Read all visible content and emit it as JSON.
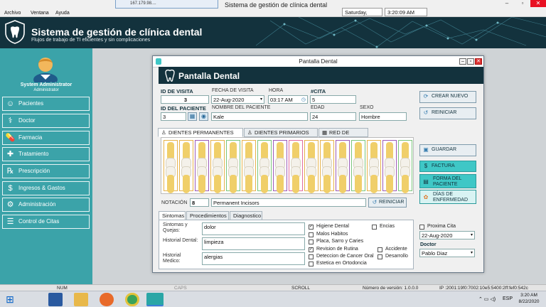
{
  "menubar": {
    "items": [
      "Archivo",
      "Ventana",
      "Ayuda"
    ],
    "rdp_host": "167.179.98....",
    "app_title": "Sistema de gestión de clínica dental",
    "day": "Saturday,",
    "time": "3:20:09 AM"
  },
  "header": {
    "title": "Sistema de gestión de clínica dental",
    "subtitle": "Flujos de trabajo de TI eficientes y sin complicaciones"
  },
  "sidebar": {
    "user_name": "System Administrator",
    "user_role": "Administrator",
    "items": [
      {
        "label": "Pacientes",
        "icon": "patients-icon"
      },
      {
        "label": "Doctor",
        "icon": "doctor-icon"
      },
      {
        "label": "Farmacia",
        "icon": "pill-icon"
      },
      {
        "label": "Tratamiento",
        "icon": "treatment-icon"
      },
      {
        "label": "Prescripción",
        "icon": "rx-icon"
      },
      {
        "label": "Ingresos & Gastos",
        "icon": "money-icon"
      },
      {
        "label": "Administración",
        "icon": "admin-icon"
      },
      {
        "label": "Control de Citas",
        "icon": "calendar-icon"
      }
    ]
  },
  "dialog": {
    "window_title": "Pantalla Dental",
    "header_title": "Pantalla Dental",
    "visit_id_label": "ID DE VISITA",
    "visit_id": "3",
    "visit_date_label": "FECHA DE VISITA",
    "visit_date": "22-Aug-2020",
    "hour_label": "HORA",
    "hour": "03:17 AM",
    "appt_label": "#CITA",
    "appt": "5",
    "patient_id_label": "ID DEL PACIENTE",
    "patient_id": "3",
    "patient_name_label": "NOMBRE DEL PACIENTE",
    "patient_name": "Kale",
    "age_label": "EDAD",
    "age": "24",
    "sex_label": "SEXO",
    "sex": "Hombre",
    "btn_new": "CREAR NUEVO",
    "btn_reset": "REINICIAR",
    "btn_save": "GUARDAR",
    "btn_invoice": "FACTURA",
    "btn_patient_form": "FORMA DEL PACIENTE",
    "btn_sick_days": "DÍAS DE ENFERMEDAD",
    "teeth_tabs": [
      "DIENTES PERMANENTES",
      "DIENTES PRIMARIOS",
      "RED DE NOTACIÓN"
    ],
    "notation_label": "NOTACIÓN",
    "notation_num": "8",
    "notation_text": "Permanent Incisors",
    "btn_notation_reset": "REINICIAR",
    "info_tabs": [
      "Sintomas",
      "Procedimientos",
      "Diagnostico"
    ],
    "symptoms_label": "Sintomas y Quejas:",
    "symptoms": "dolor",
    "dental_history_label": "Historial Dental:",
    "dental_history": "limpieza",
    "medical_history_label": "Historial Medico:",
    "medical_history": "alergias",
    "checks": [
      {
        "label": "Higiene Dental",
        "checked": true
      },
      {
        "label": "Encias",
        "checked": false
      },
      {
        "label": "Malos Habitos",
        "checked": false
      },
      {
        "label": "Placa, Sarro y Caries",
        "checked": false
      },
      {
        "label": "Revision de Rutina",
        "checked": true
      },
      {
        "label": "Accidente",
        "checked": false
      },
      {
        "label": "Deteccion de Cancer Oral",
        "checked": false
      },
      {
        "label": "Desarrollo",
        "checked": false
      },
      {
        "label": "Estetica en Ortodoncia",
        "checked": false
      }
    ],
    "next_appt_label": "Proxima Cita",
    "next_appt_date": "22-Aug-2020",
    "doctor_label": "Doctor",
    "doctor": "Pablo Diaz"
  },
  "statusbar": {
    "num": "NUM",
    "caps": "CAPS",
    "scroll": "SCROLL",
    "version": "Número de versión: 1.0.0.0",
    "ip": "IP :2001:19f0:7002:10e5:5400:2ff:fef0:542c"
  },
  "taskbar": {
    "time": "3:20 AM",
    "date": "8/22/2020",
    "lang": "ESP"
  },
  "teeth_colors": [
    "#e6b24a",
    "#e6b24a",
    "#9b59b6",
    "#e6b24a",
    "#7bc67b",
    "#e6b24a",
    "#7bc67b",
    "#9b59b6",
    "#e06c9f",
    "#e6b24a",
    "#e6b24a",
    "#9b59b6",
    "#7bc67b",
    "#e6b24a",
    "#9b59b6",
    "#7bc67b"
  ]
}
